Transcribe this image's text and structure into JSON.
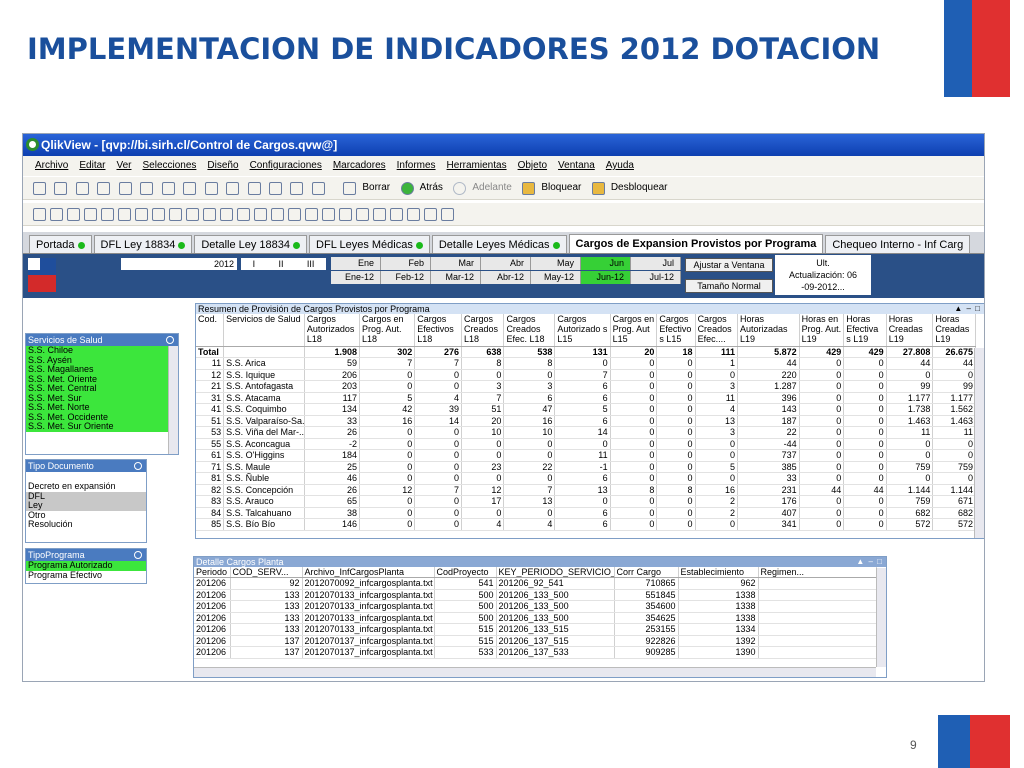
{
  "slide": {
    "title": "IMPLEMENTACION DE INDICADORES 2012 DOTACION",
    "page_number": "9",
    "colors": {
      "title": "#1a4f9c",
      "deco_blue": "#1f5fb4",
      "deco_red": "#e03030"
    }
  },
  "app": {
    "window_title": "QlikView - [qvp://bi.sirh.cl/Control de Cargos.qvw@]"
  },
  "menu": [
    "Archivo",
    "Editar",
    "Ver",
    "Selecciones",
    "Diseño",
    "Configuraciones",
    "Marcadores",
    "Informes",
    "Herramientas",
    "Objeto",
    "Ventana",
    "Ayuda"
  ],
  "toolbar": {
    "borrar": "Borrar",
    "atras": "Atrás",
    "adelante": "Adelante",
    "bloquear": "Bloquear",
    "desbloquear": "Desbloquear"
  },
  "tabs": [
    {
      "label": "Portada",
      "dot": true
    },
    {
      "label": "DFL Ley 18834",
      "dot": true
    },
    {
      "label": "Detalle Ley 18834",
      "dot": true
    },
    {
      "label": "DFL Leyes Médicas",
      "dot": true
    },
    {
      "label": "Detalle Leyes Médicas",
      "dot": true
    },
    {
      "label": "Cargos de Expansion Provistos por Programa",
      "dot": false,
      "active": true
    },
    {
      "label": "Chequeo Interno - Inf Carg",
      "dot": false
    }
  ],
  "filters": {
    "year": "2012",
    "quarters": [
      "I",
      "II",
      "III"
    ],
    "months_top": [
      "Ene",
      "Feb",
      "Mar",
      "Abr",
      "May",
      "Jun",
      "Jul"
    ],
    "months_bottom": [
      "Ene-12",
      "Feb-12",
      "Mar-12",
      "Abr-12",
      "May-12",
      "Jun-12",
      "Jul-12"
    ],
    "selected_month": "Jun-12",
    "ajustar": "Ajustar a Ventana",
    "tamano": "Tamaño Normal",
    "ult": [
      "Ult.",
      "Actualización: 06",
      "-09-2012..."
    ]
  },
  "servicios": {
    "title": "Servicios de Salud",
    "items": [
      "S.S. Chiloe",
      "S.S. Aysén",
      "S.S. Magallanes",
      "S.S. Met. Oriente",
      "S.S. Met. Central",
      "S.S. Met. Sur",
      "S.S. Met. Norte",
      "S.S. Met. Occidente",
      "S.S. Met. Sur Oriente"
    ]
  },
  "tipo_documento": {
    "title": "Tipo Documento",
    "items": [
      {
        "label": "Decreto en expansión",
        "state": "w"
      },
      {
        "label": "DFL",
        "state": "gr"
      },
      {
        "label": "Ley",
        "state": "gr"
      },
      {
        "label": "Otro",
        "state": "w"
      },
      {
        "label": "Resolución",
        "state": "w"
      }
    ]
  },
  "tipo_programa": {
    "title": "TipoPrograma",
    "items": [
      {
        "label": "Programa Autorizado",
        "state": "g"
      },
      {
        "label": "Programa Efectivo",
        "state": "w"
      }
    ]
  },
  "resumen": {
    "title": "Resumen de Provisión de Cargos Provistos por Programa",
    "headers": [
      "Cod.",
      "Servicios de Salud",
      "Cargos Autorizados L18",
      "Cargos en Prog. Aut. L18",
      "Cargos Efectivos L18",
      "Cargos Creados L18",
      "Cargos Creados Efec. L18",
      "Cargos Autorizado s L15",
      "Cargos en Prog. Aut L15",
      "Cargos Efectivo s L15",
      "Cargos Creados Efec....",
      "Horas Autorizadas L19",
      "Horas en Prog. Aut. L19",
      "Horas Efectiva s L19",
      "Horas Creadas L19",
      "Horas Creadas L19"
    ],
    "total": [
      "Total",
      "",
      "1.908",
      "302",
      "276",
      "638",
      "538",
      "131",
      "20",
      "18",
      "111",
      "5.872",
      "429",
      "429",
      "27.808",
      "26.675"
    ],
    "rows": [
      [
        "11",
        "S.S. Arica",
        "59",
        "7",
        "7",
        "8",
        "8",
        "0",
        "0",
        "0",
        "1",
        "44",
        "0",
        "0",
        "44",
        "44"
      ],
      [
        "12",
        "S.S. Iquique",
        "206",
        "0",
        "0",
        "0",
        "0",
        "7",
        "0",
        "0",
        "0",
        "220",
        "0",
        "0",
        "0",
        "0"
      ],
      [
        "21",
        "S.S. Antofagasta",
        "203",
        "0",
        "0",
        "3",
        "3",
        "6",
        "0",
        "0",
        "3",
        "1.287",
        "0",
        "0",
        "99",
        "99"
      ],
      [
        "31",
        "S.S. Atacama",
        "117",
        "5",
        "4",
        "7",
        "6",
        "6",
        "0",
        "0",
        "11",
        "396",
        "0",
        "0",
        "1.177",
        "1.177"
      ],
      [
        "41",
        "S.S. Coquimbo",
        "134",
        "42",
        "39",
        "51",
        "47",
        "5",
        "0",
        "0",
        "4",
        "143",
        "0",
        "0",
        "1.738",
        "1.562"
      ],
      [
        "51",
        "S.S. Valparaíso-Sa...",
        "33",
        "16",
        "14",
        "20",
        "16",
        "6",
        "0",
        "0",
        "13",
        "187",
        "0",
        "0",
        "1.463",
        "1.463"
      ],
      [
        "53",
        "S.S. Viña del Mar-...",
        "26",
        "0",
        "0",
        "10",
        "10",
        "14",
        "0",
        "0",
        "3",
        "22",
        "0",
        "0",
        "11",
        "11"
      ],
      [
        "55",
        "S.S. Aconcagua",
        "-2",
        "0",
        "0",
        "0",
        "0",
        "0",
        "0",
        "0",
        "0",
        "-44",
        "0",
        "0",
        "0",
        "0"
      ],
      [
        "61",
        "S.S. O'Higgins",
        "184",
        "0",
        "0",
        "0",
        "0",
        "11",
        "0",
        "0",
        "0",
        "737",
        "0",
        "0",
        "0",
        "0"
      ],
      [
        "71",
        "S.S. Maule",
        "25",
        "0",
        "0",
        "23",
        "22",
        "-1",
        "0",
        "0",
        "5",
        "385",
        "0",
        "0",
        "759",
        "759"
      ],
      [
        "81",
        "S.S. Ñuble",
        "46",
        "0",
        "0",
        "0",
        "0",
        "6",
        "0",
        "0",
        "0",
        "33",
        "0",
        "0",
        "0",
        "0"
      ],
      [
        "82",
        "S.S. Concepción",
        "26",
        "12",
        "7",
        "12",
        "7",
        "13",
        "8",
        "8",
        "16",
        "231",
        "44",
        "44",
        "1.144",
        "1.144"
      ],
      [
        "83",
        "S.S. Arauco",
        "65",
        "0",
        "0",
        "17",
        "13",
        "0",
        "0",
        "0",
        "2",
        "176",
        "0",
        "0",
        "759",
        "671"
      ],
      [
        "84",
        "S.S. Talcahuano",
        "38",
        "0",
        "0",
        "0",
        "0",
        "6",
        "0",
        "0",
        "2",
        "407",
        "0",
        "0",
        "682",
        "682"
      ],
      [
        "85",
        "S.S. Bío Bío",
        "146",
        "0",
        "0",
        "4",
        "4",
        "6",
        "0",
        "0",
        "0",
        "341",
        "0",
        "0",
        "572",
        "572"
      ]
    ]
  },
  "detalle": {
    "title": "Detalle Cargos Planta",
    "headers": [
      "Periodo",
      "COD_SERV...",
      "Archivo_InfCargosPlanta",
      "CodProyecto",
      "KEY_PERIODO_SERVICIO_PROYE...",
      "Corr Cargo",
      "Establecimiento",
      "Regimen..."
    ],
    "rows": [
      [
        "201206",
        "92",
        "2012070092_infcargosplanta.txt",
        "541",
        "201206_92_541",
        "710865",
        "962",
        ""
      ],
      [
        "201206",
        "133",
        "2012070133_infcargosplanta.txt",
        "500",
        "201206_133_500",
        "551845",
        "1338",
        ""
      ],
      [
        "201206",
        "133",
        "2012070133_infcargosplanta.txt",
        "500",
        "201206_133_500",
        "354600",
        "1338",
        ""
      ],
      [
        "201206",
        "133",
        "2012070133_infcargosplanta.txt",
        "500",
        "201206_133_500",
        "354625",
        "1338",
        ""
      ],
      [
        "201206",
        "133",
        "2012070133_infcargosplanta.txt",
        "515",
        "201206_133_515",
        "253155",
        "1334",
        ""
      ],
      [
        "201206",
        "137",
        "2012070137_infcargosplanta.txt",
        "515",
        "201206_137_515",
        "922826",
        "1392",
        ""
      ],
      [
        "201206",
        "137",
        "2012070137_infcargosplanta.txt",
        "533",
        "201206_137_533",
        "909285",
        "1390",
        ""
      ]
    ]
  }
}
